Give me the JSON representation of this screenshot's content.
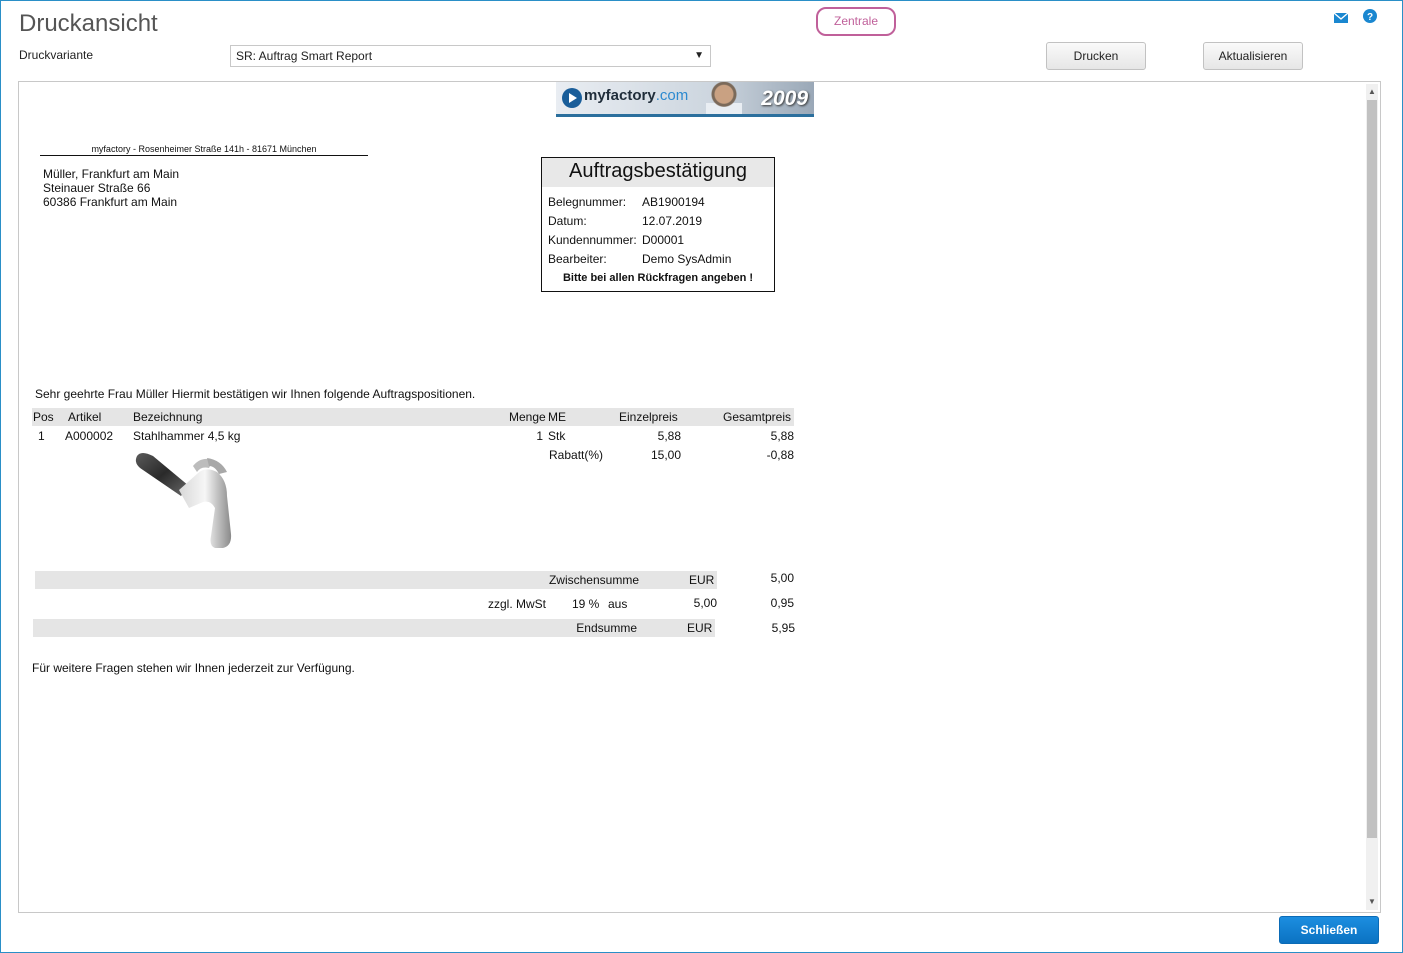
{
  "window": {
    "title": "Druckansicht",
    "zentrale": "Zentrale",
    "mail_icon": "mail-icon",
    "help_icon": "help-icon"
  },
  "toolbar": {
    "variante_label": "Druckvariante",
    "variante_value": "SR: Auftrag Smart Report",
    "print_label": "Drucken",
    "refresh_label": "Aktualisieren"
  },
  "document": {
    "banner": {
      "brand": "myfactory",
      "domain": ".com",
      "year": "2009"
    },
    "sender_line": "myfactory - Rosenheimer Straße 141h - 81671 München",
    "recipient": [
      "Müller, Frankfurt am Main",
      "Steinauer Straße 66",
      "60386 Frankfurt am Main"
    ],
    "box": {
      "title": "Auftragsbestätigung",
      "rows": [
        {
          "k": "Belegnummer:",
          "v": "AB1900194"
        },
        {
          "k": "Datum:",
          "v": "12.07.2019"
        },
        {
          "k": "Kundennummer:",
          "v": "D00001"
        },
        {
          "k": "Bearbeiter:",
          "v": "Demo SysAdmin"
        }
      ],
      "note": "Bitte bei allen Rückfragen angeben !"
    },
    "greeting": "Sehr geehrte Frau Müller Hiermit bestätigen wir Ihnen folgende Auftragspositionen.",
    "table": {
      "headers": {
        "pos": "Pos",
        "artikel": "Artikel",
        "bezeichnung": "Bezeichnung",
        "menge": "Menge",
        "me": "ME",
        "einzelpreis": "Einzelpreis",
        "gesamtpreis": "Gesamtpreis"
      },
      "row": {
        "pos": "1",
        "artikel": "A000002",
        "bezeichnung": "Stahlhammer 4,5 kg",
        "menge": "1",
        "me": "Stk",
        "einzelpreis": "5,88",
        "gesamtpreis": "5,88"
      },
      "discount": {
        "label": "Rabatt(%)",
        "value": "15,00",
        "amount": "-0,88"
      }
    },
    "totals": {
      "zwischensumme_label": "Zwischensumme",
      "zwischensumme_cur": "EUR",
      "zwischensumme_value": "5,00",
      "mwst_label": "zzgl. MwSt",
      "mwst_rate": "19 %",
      "mwst_from": "aus",
      "mwst_base": "5,00",
      "mwst_value": "0,95",
      "endsumme_label": "Endsumme",
      "endsumme_cur": "EUR",
      "endsumme_value": "5,95"
    },
    "closing": "Für weitere Fragen stehen wir Ihnen jederzeit zur Verfügung."
  },
  "footer": {
    "close_label": "Schließen"
  },
  "colors": {
    "accent": "#0f7fd1",
    "zentrale": "#c0609a",
    "frame": "#2a8fc7"
  }
}
